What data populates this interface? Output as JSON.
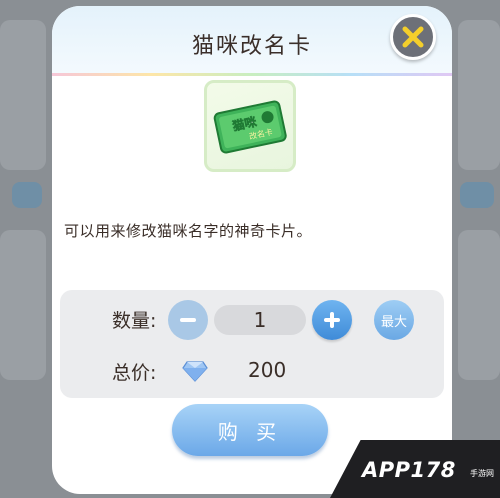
{
  "dialog": {
    "title": "猫咪改名卡",
    "item_icon": "cat-rename-card-icon",
    "card_text_top": "猫咪",
    "card_text_bottom": "改名卡",
    "description": "可以用来修改猫咪名字的神奇卡片。",
    "quantity_label": "数量:",
    "quantity_value": "1",
    "max_label": "最大",
    "total_label": "总价:",
    "total_value": "200",
    "currency_icon": "diamond-icon",
    "buy_label": "购 买",
    "close_icon": "close-icon"
  },
  "watermark": {
    "text": "APP178",
    "sub": "手游网"
  },
  "colors": {
    "accent_blue": "#3f8bd8",
    "close_x": "#f4cf2b",
    "card_green": "#3fb35a"
  }
}
